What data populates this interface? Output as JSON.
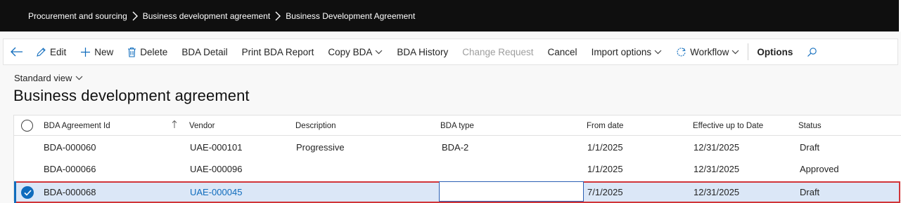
{
  "breadcrumb": {
    "items": [
      "Procurement and sourcing",
      "Business development agreement",
      "Business Development Agreement"
    ]
  },
  "actionbar": {
    "edit": "Edit",
    "new": "New",
    "delete": "Delete",
    "bda_detail": "BDA Detail",
    "print_bda_report": "Print BDA Report",
    "copy_bda": "Copy BDA",
    "bda_history": "BDA History",
    "change_request": "Change Request",
    "cancel": "Cancel",
    "import_options": "Import options",
    "workflow": "Workflow",
    "options": "Options"
  },
  "view": {
    "label": "Standard view"
  },
  "page": {
    "title": "Business development agreement"
  },
  "grid": {
    "columns": {
      "id": "BDA Agreement Id",
      "vendor": "Vendor",
      "description": "Description",
      "type": "BDA type",
      "from": "From date",
      "effective": "Effective up to Date",
      "status": "Status"
    },
    "rows": [
      {
        "id": "BDA-000060",
        "vendor": "UAE-000101",
        "description": "Progressive",
        "type": "BDA-2",
        "from": "1/1/2025",
        "effective": "12/31/2025",
        "status": "Draft"
      },
      {
        "id": "BDA-000066",
        "vendor": "UAE-000096",
        "description": "",
        "type": "",
        "from": "1/1/2025",
        "effective": "12/31/2025",
        "status": "Approved"
      },
      {
        "id": "BDA-000068",
        "vendor": "UAE-000045",
        "description": "",
        "type": "",
        "from": "7/1/2025",
        "effective": "12/31/2025",
        "status": "Draft"
      }
    ],
    "selected_row": 2
  },
  "colors": {
    "accent": "#0f6cbd",
    "highlight_border": "#d13438",
    "selected_row_bg": "#dbe7f7",
    "topbar_bg": "#0f0f0f"
  }
}
